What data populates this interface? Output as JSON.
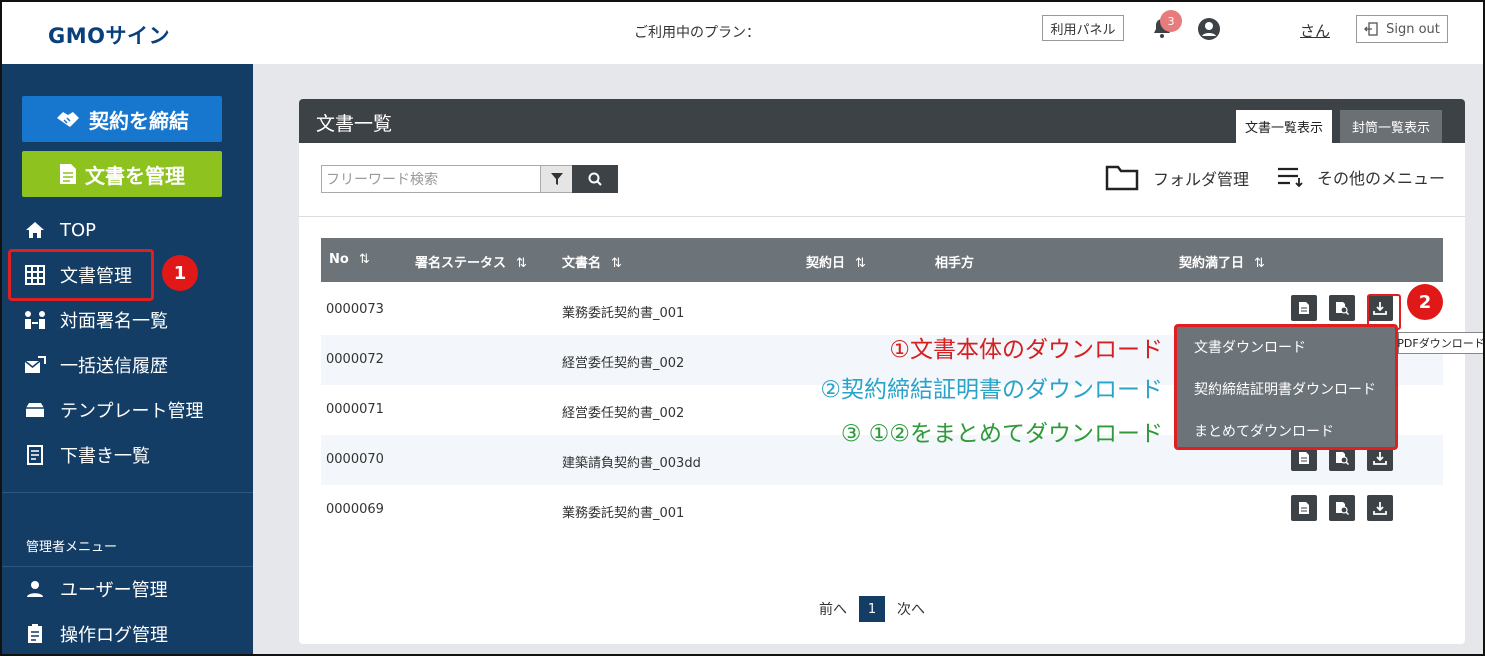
{
  "header": {
    "logo": "GMOサイン",
    "plan_label": "ご利用中のプラン：",
    "panel_button": "利用パネル",
    "notification_count": "3",
    "user_name": "さん",
    "signout_label": "Sign out"
  },
  "sidebar": {
    "contract_button": "契約を締結",
    "manage_button": "文書を管理",
    "items": [
      {
        "label": "TOP",
        "icon": "home-icon"
      },
      {
        "label": "文書管理",
        "icon": "grid-icon"
      },
      {
        "label": "対面署名一覧",
        "icon": "face-to-face-icon"
      },
      {
        "label": "一括送信履歴",
        "icon": "bulk-send-icon"
      },
      {
        "label": "テンプレート管理",
        "icon": "template-icon"
      },
      {
        "label": "下書き一覧",
        "icon": "draft-icon"
      }
    ],
    "admin_title": "管理者メニュー",
    "admin_items": [
      {
        "label": "ユーザー管理",
        "icon": "user-icon"
      },
      {
        "label": "操作ログ管理",
        "icon": "log-icon"
      }
    ]
  },
  "main": {
    "title": "文書一覧",
    "tabs": [
      {
        "label": "文書一覧表示",
        "active": true
      },
      {
        "label": "封筒一覧表示",
        "active": false
      }
    ],
    "search_placeholder": "フリーワード検索",
    "folder_label": "フォルダ管理",
    "other_menu_label": "その他のメニュー",
    "columns": [
      "No",
      "署名ステータス",
      "文書名",
      "契約日",
      "相手方",
      "契約満了日"
    ],
    "rows": [
      {
        "no": "0000073",
        "name": "業務委託契約書_001"
      },
      {
        "no": "0000072",
        "name": "経営委任契約書_002"
      },
      {
        "no": "0000071",
        "name": "経営委任契約書_002"
      },
      {
        "no": "0000070",
        "name": "建築請負契約書_003dd"
      },
      {
        "no": "0000069",
        "name": "業務委託契約書_001"
      }
    ],
    "pager": {
      "prev": "前へ",
      "current": "1",
      "next": "次へ"
    }
  },
  "download": {
    "tooltip": "PDFダウンロード",
    "menu_items": [
      "文書ダウンロード",
      "契約締結証明書ダウンロード",
      "まとめてダウンロード"
    ]
  },
  "annotations": {
    "badge1": "1",
    "badge2": "2",
    "notes": [
      {
        "text": "①文書本体のダウンロード",
        "color": "#d42020"
      },
      {
        "text": "②契約締結証明書のダウンロード",
        "color": "#2aa3c9"
      },
      {
        "text": "③ ①②をまとめてダウンロード",
        "color": "#2e9a3a"
      }
    ]
  },
  "colors": {
    "sidebar_bg": "#143d66",
    "contract_button": "#1777cf",
    "manage_button": "#8dc21f",
    "highlight_red": "#e02020"
  }
}
